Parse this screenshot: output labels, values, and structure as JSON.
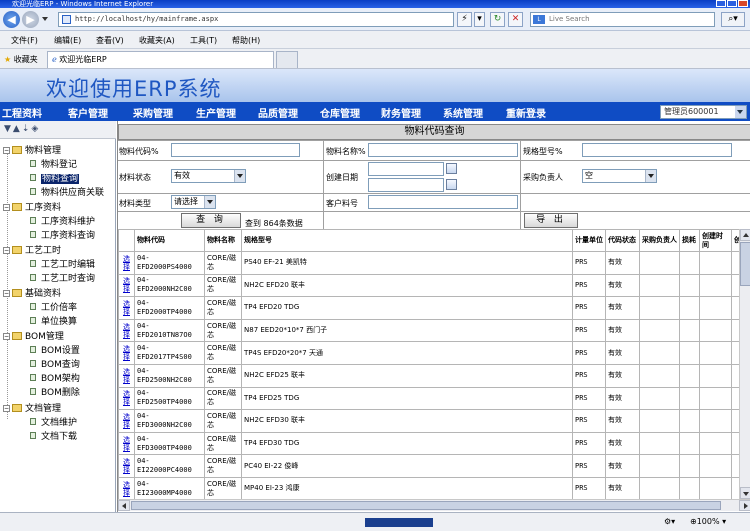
{
  "browser": {
    "window_title": "欢迎光临ERP - Windows Internet Explorer",
    "address": "http://localhost/hy/mainframe.aspx",
    "search_placeholder": "Live Search",
    "menu": [
      "文件(F)",
      "编辑(E)",
      "查看(V)",
      "收藏夹(A)",
      "工具(T)",
      "帮助(H)"
    ],
    "favorites_label": "收藏夹",
    "tab_title": "欢迎光临ERP",
    "zoom": "100%"
  },
  "app": {
    "title": "欢迎使用ERP系统",
    "nav": [
      "工程资料",
      "客户管理",
      "采购管理",
      "生产管理",
      "品质管理",
      "仓库管理",
      "财务管理",
      "系统管理",
      "重新登录"
    ],
    "user": "管理员600001"
  },
  "sidebar": {
    "groups": [
      {
        "label": "物料管理",
        "items": [
          "物料登记",
          "物料查询",
          "物料供应商关联"
        ]
      },
      {
        "label": "工序资料",
        "items": [
          "工序资料维护",
          "工序资料查询"
        ]
      },
      {
        "label": "工艺工时",
        "items": [
          "工艺工时编辑",
          "工艺工时查询"
        ]
      },
      {
        "label": "基础资料",
        "items": [
          "工价倍率",
          "单位换算"
        ]
      },
      {
        "label": "BOM管理",
        "items": [
          "BOM设置",
          "BOM查询",
          "BOM架构",
          "BOM删除"
        ]
      },
      {
        "label": "文档管理",
        "items": [
          "文档维护",
          "文档下载"
        ]
      }
    ],
    "selected": "物料查询"
  },
  "query": {
    "title": "物料代码查询",
    "labels": {
      "code": "物料代码%",
      "name": "物料名称%",
      "spec": "规格型号%",
      "status": "材料状态",
      "create_date": "创建日期",
      "buyer": "采购负责人",
      "type": "材料类型",
      "customer_no": "客户料号"
    },
    "values": {
      "status": "有效",
      "buyer": "空",
      "type": "请选择"
    },
    "search_btn": "查 询",
    "result_text": "查到 864条数据",
    "export_btn": "导 出"
  },
  "table": {
    "headers": [
      "",
      "物料代码",
      "物料名称",
      "规格型号",
      "计量单位",
      "代码状态",
      "采购负责人",
      "损耗",
      "创建时间",
      "创"
    ],
    "select_label": "选择",
    "rows": [
      [
        "04-EFD2000PS4000",
        "CORE/磁芯",
        "PS40 EF-21 美凯特",
        "PRS",
        "有效"
      ],
      [
        "04-EFD2000NH2C00",
        "CORE/磁芯",
        "NH2C EFD20 联丰",
        "PRS",
        "有效"
      ],
      [
        "04-EFD2000TP4000",
        "CORE/磁芯",
        "TP4 EFD20 TDG",
        "PRS",
        "有效"
      ],
      [
        "04-EFD2010TN87O0",
        "CORE/磁芯",
        "N87 EED20*10*7 西门子",
        "PRS",
        "有效"
      ],
      [
        "04-EFD2017TP4S00",
        "CORE/磁芯",
        "TP4S EFD20*20*7 天通",
        "PRS",
        "有效"
      ],
      [
        "04-EFD2500NH2C00",
        "CORE/磁芯",
        "NH2C EFD25 联丰",
        "PRS",
        "有效"
      ],
      [
        "04-EFD2500TP4000",
        "CORE/磁芯",
        "TP4 EFD25 TDG",
        "PRS",
        "有效"
      ],
      [
        "04-EFD3000NH2C00",
        "CORE/磁芯",
        "NH2C EFD30 联丰",
        "PRS",
        "有效"
      ],
      [
        "04-EFD3000TP4000",
        "CORE/磁芯",
        "TP4 EFD30 TDG",
        "PRS",
        "有效"
      ],
      [
        "04-EI22000PC4000",
        "CORE/磁芯",
        "PC40 EI-22 俊峰",
        "PRS",
        "有效"
      ],
      [
        "04-EI23000MP4000",
        "CORE/磁芯",
        "MP40 EI-23 鸿康",
        "PRS",
        "有效"
      ]
    ]
  },
  "colors": {
    "nav_bg": "#0f4cc4",
    "title_color": "#1f57c2",
    "selected_bg": "#0a246a",
    "link": "#0000cc"
  }
}
